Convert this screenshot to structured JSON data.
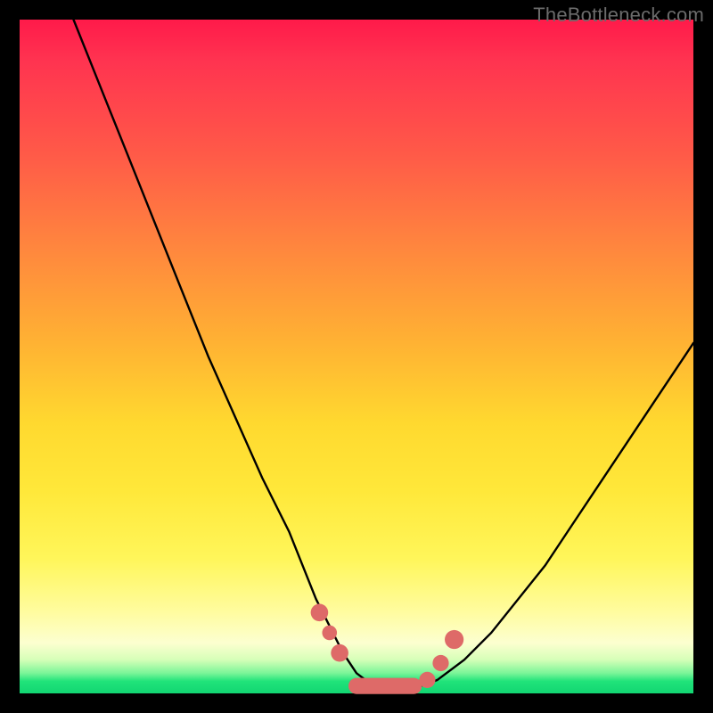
{
  "watermark": "TheBottleneck.com",
  "chart_data": {
    "type": "line",
    "title": "",
    "xlabel": "",
    "ylabel": "",
    "xlim": [
      0,
      100
    ],
    "ylim": [
      0,
      100
    ],
    "grid": false,
    "legend": false,
    "series": [
      {
        "name": "curve",
        "x": [
          8,
          12,
          16,
          20,
          24,
          28,
          32,
          36,
          40,
          44,
          46,
          48,
          50,
          52,
          54,
          56,
          58,
          60,
          62,
          66,
          70,
          74,
          78,
          82,
          86,
          90,
          94,
          98,
          100
        ],
        "y": [
          100,
          90,
          80,
          70,
          60,
          50,
          41,
          32,
          24,
          14,
          10,
          6,
          3,
          1.5,
          1,
          1,
          1,
          1.2,
          2,
          5,
          9,
          14,
          19,
          25,
          31,
          37,
          43,
          49,
          52
        ]
      }
    ],
    "markers": [
      {
        "name": "dot-left-upper",
        "x": 44.5,
        "y": 12,
        "r": 1.3
      },
      {
        "name": "dot-left-mid",
        "x": 46.0,
        "y": 9,
        "r": 1.1
      },
      {
        "name": "dot-left-lower",
        "x": 47.5,
        "y": 6,
        "r": 1.3
      },
      {
        "name": "pill-bottom",
        "x0": 50,
        "x1": 58.5,
        "y": 1.1,
        "r": 1.2
      },
      {
        "name": "dot-right-lower",
        "x": 60.5,
        "y": 2.0,
        "r": 1.2
      },
      {
        "name": "dot-right-mid",
        "x": 62.5,
        "y": 4.5,
        "r": 1.2
      },
      {
        "name": "dot-right-upper",
        "x": 64.5,
        "y": 8.0,
        "r": 1.4
      }
    ],
    "colors": {
      "curve": "#000000",
      "marker": "#de6a68",
      "bg_top": "#ff1a4a",
      "bg_mid": "#ffd92f",
      "bg_bottom": "#12d672",
      "frame": "#000000"
    }
  }
}
